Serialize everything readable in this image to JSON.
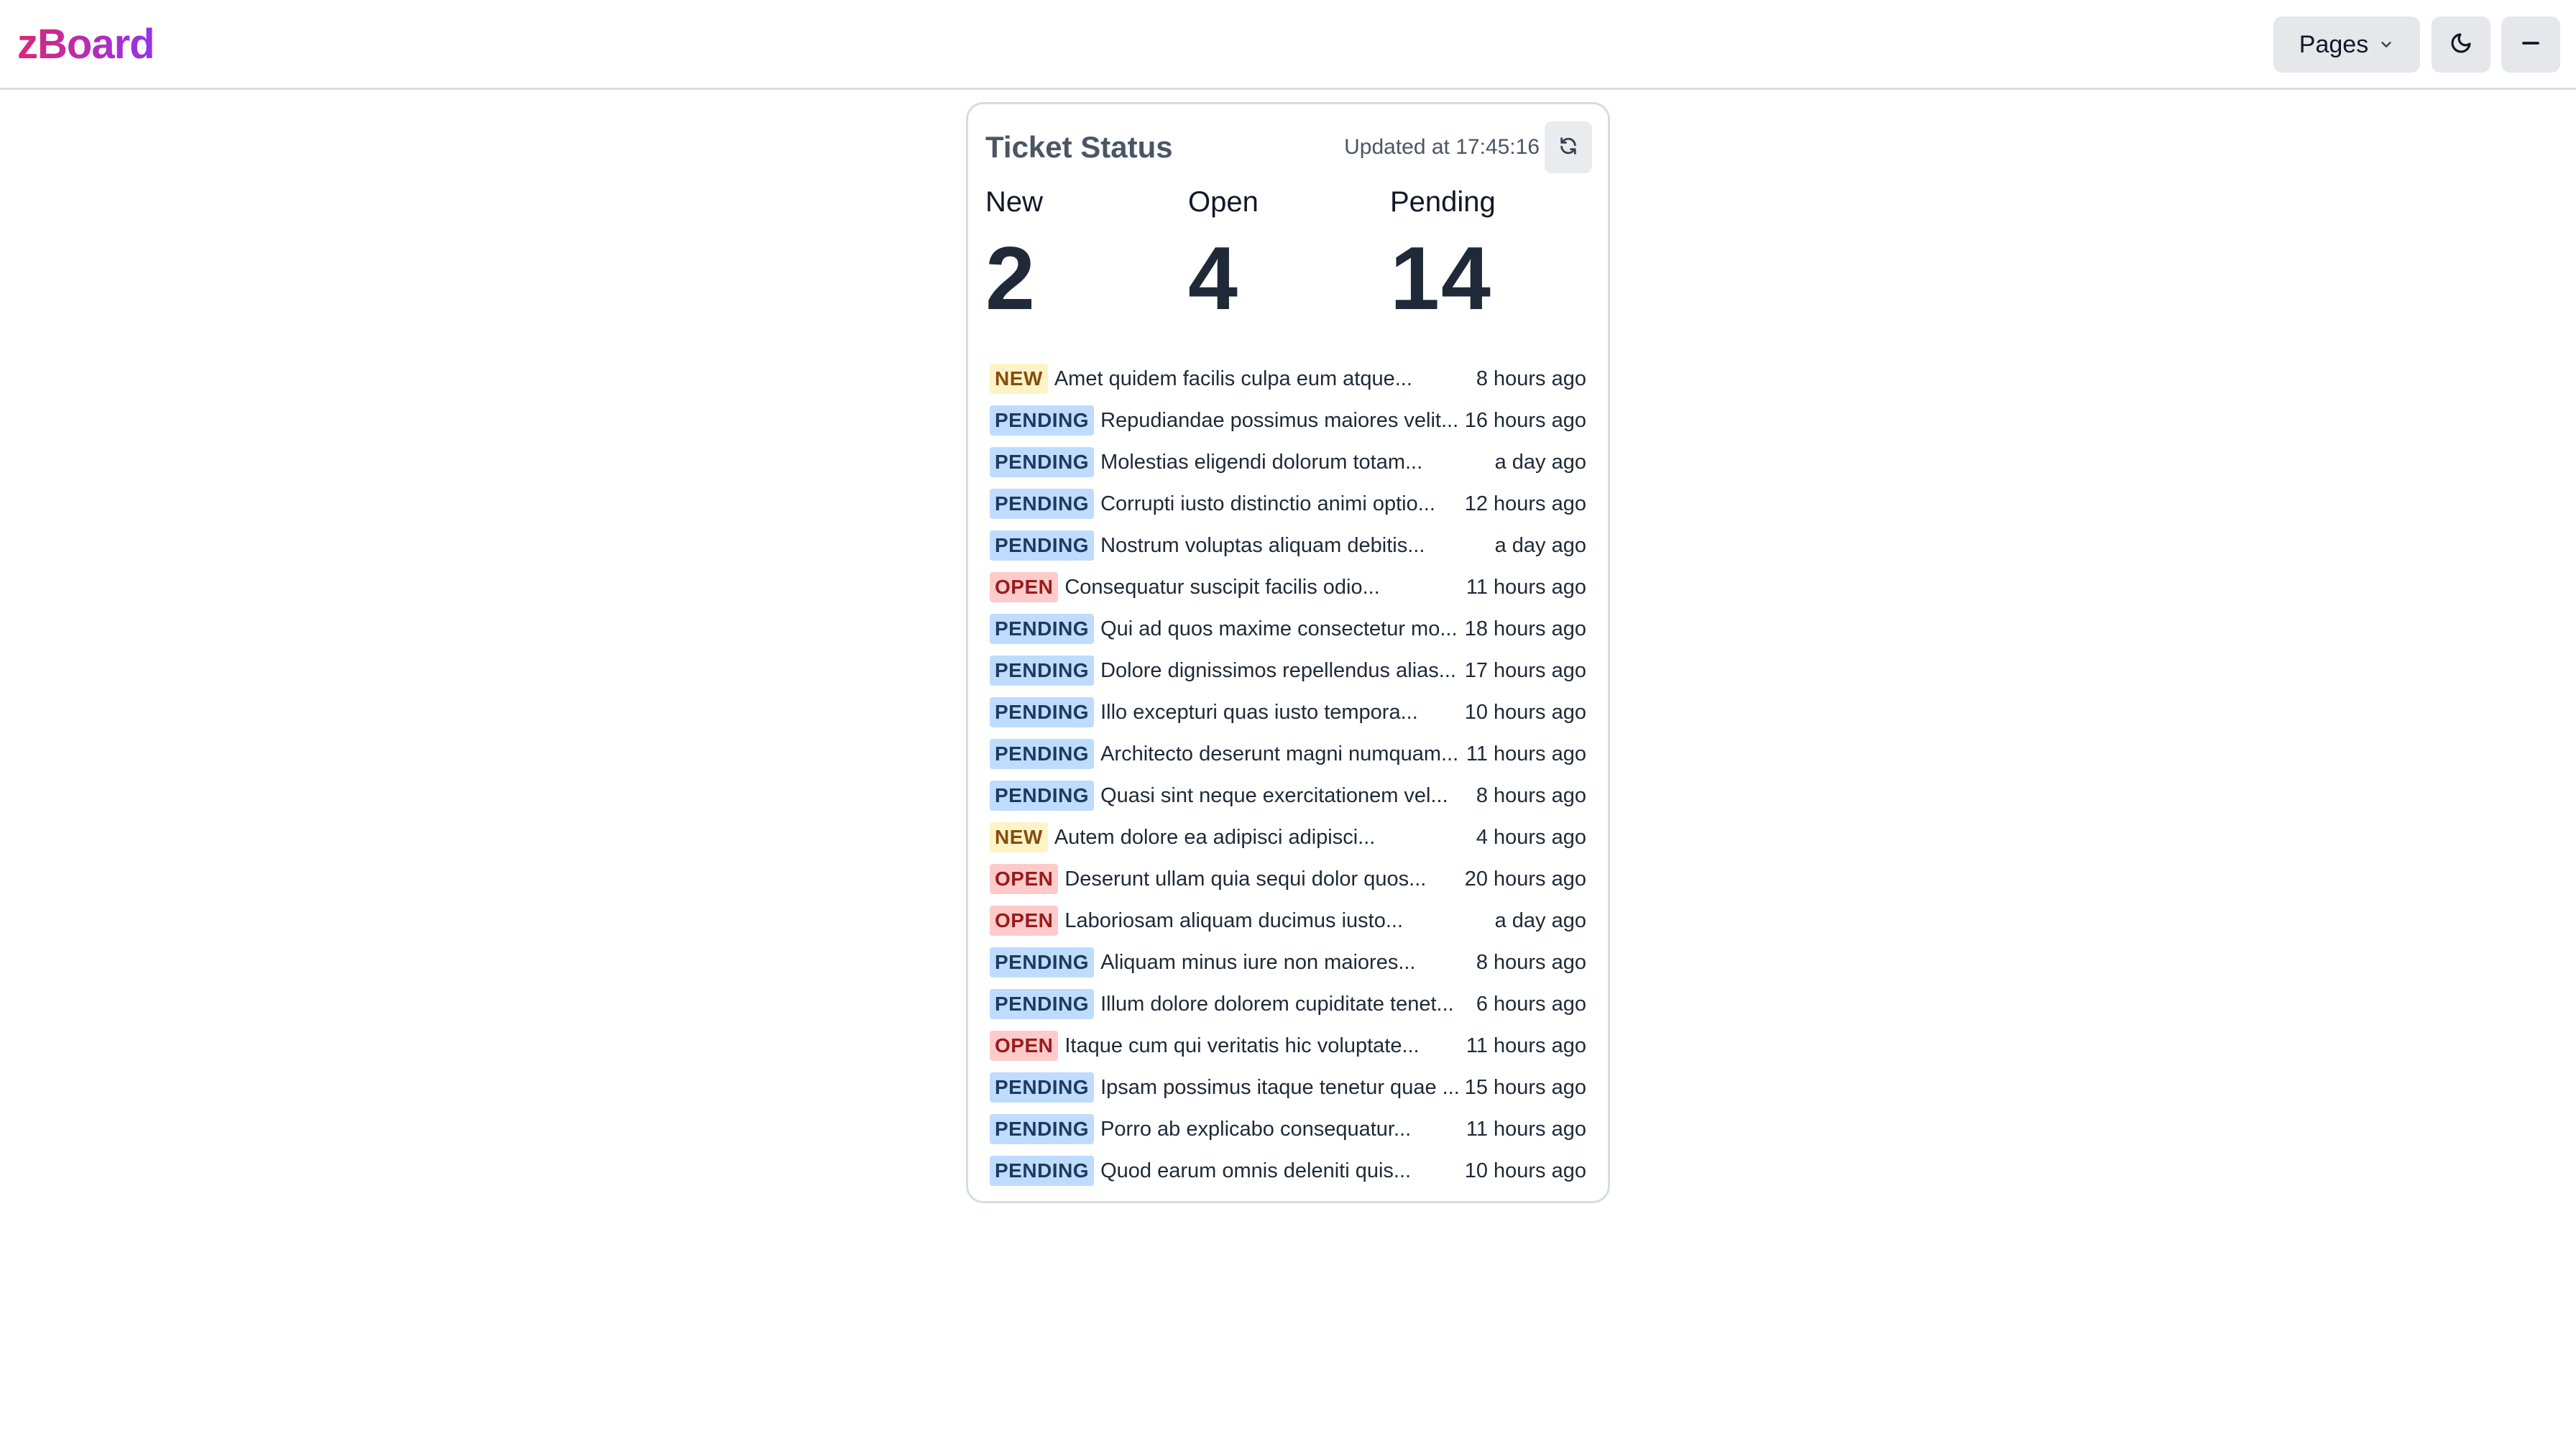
{
  "app": {
    "logo": "zBoard"
  },
  "header": {
    "pages_label": "Pages",
    "icons": {
      "pages_chevron": "chevron-down-icon",
      "theme": "moon-icon",
      "menu": "minus-icon"
    }
  },
  "card": {
    "title": "Ticket Status",
    "updated": "Updated at 17:45:16",
    "refresh_icon": "refresh-icon",
    "stats": [
      {
        "label": "New",
        "value": "2"
      },
      {
        "label": "Open",
        "value": "4"
      },
      {
        "label": "Pending",
        "value": "14"
      }
    ],
    "tickets": [
      {
        "status": "NEW",
        "subject": "Amet quidem facilis culpa eum atque...",
        "time": "8 hours ago"
      },
      {
        "status": "PENDING",
        "subject": "Repudiandae possimus maiores velit...",
        "time": "16 hours ago"
      },
      {
        "status": "PENDING",
        "subject": "Molestias eligendi dolorum totam...",
        "time": "a day ago"
      },
      {
        "status": "PENDING",
        "subject": "Corrupti iusto distinctio animi optio...",
        "time": "12 hours ago"
      },
      {
        "status": "PENDING",
        "subject": "Nostrum voluptas aliquam debitis...",
        "time": "a day ago"
      },
      {
        "status": "OPEN",
        "subject": "Consequatur suscipit facilis odio...",
        "time": "11 hours ago"
      },
      {
        "status": "PENDING",
        "subject": "Qui ad quos maxime consectetur mo...",
        "time": "18 hours ago"
      },
      {
        "status": "PENDING",
        "subject": "Dolore dignissimos repellendus alias...",
        "time": "17 hours ago"
      },
      {
        "status": "PENDING",
        "subject": "Illo excepturi quas iusto tempora...",
        "time": "10 hours ago"
      },
      {
        "status": "PENDING",
        "subject": "Architecto deserunt magni numquam...",
        "time": "11 hours ago"
      },
      {
        "status": "PENDING",
        "subject": "Quasi sint neque exercitationem vel...",
        "time": "8 hours ago"
      },
      {
        "status": "NEW",
        "subject": "Autem dolore ea adipisci adipisci...",
        "time": "4 hours ago"
      },
      {
        "status": "OPEN",
        "subject": "Deserunt ullam quia sequi dolor quos...",
        "time": "20 hours ago"
      },
      {
        "status": "OPEN",
        "subject": "Laboriosam aliquam ducimus iusto...",
        "time": "a day ago"
      },
      {
        "status": "PENDING",
        "subject": "Aliquam minus iure non maiores...",
        "time": "8 hours ago"
      },
      {
        "status": "PENDING",
        "subject": "Illum dolore dolorem cupiditate tenet...",
        "time": "6 hours ago"
      },
      {
        "status": "OPEN",
        "subject": "Itaque cum qui veritatis hic voluptate...",
        "time": "11 hours ago"
      },
      {
        "status": "PENDING",
        "subject": "Ipsam possimus itaque tenetur quae ...",
        "time": "15 hours ago"
      },
      {
        "status": "PENDING",
        "subject": "Porro ab explicabo consequatur...",
        "time": "11 hours ago"
      },
      {
        "status": "PENDING",
        "subject": "Quod earum omnis deleniti quis...",
        "time": "10 hours ago"
      }
    ]
  },
  "colors": {
    "logo_gradient_start": "#db2777",
    "logo_gradient_end": "#9333ea",
    "badge_new_bg": "#fef3c7",
    "badge_pending_bg": "#bfdbfe",
    "badge_open_bg": "#fecaca"
  }
}
